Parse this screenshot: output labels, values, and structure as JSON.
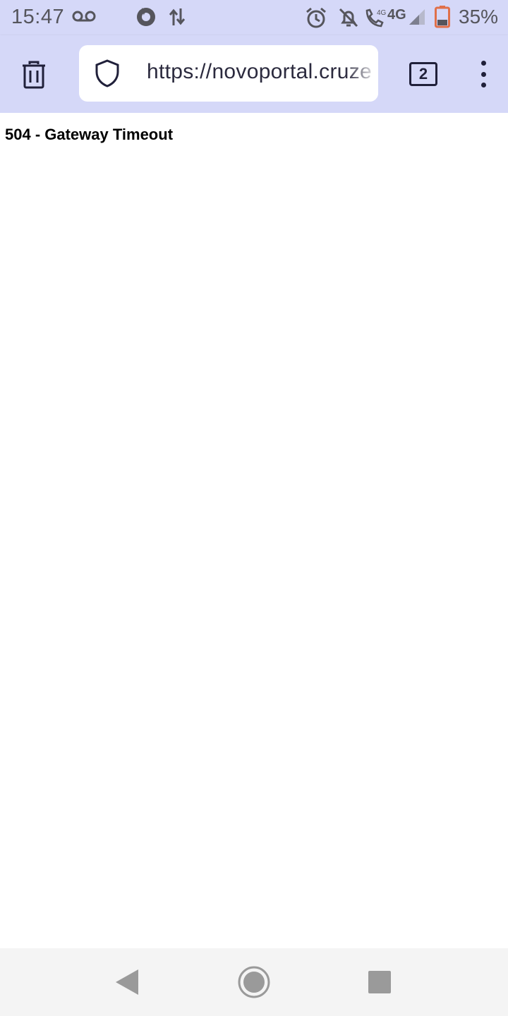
{
  "status_bar": {
    "time": "15:47",
    "network": "4G",
    "battery_percent": "35%",
    "battery_level": 0.35,
    "icons": [
      "voicemail-icon",
      "firefox-icon",
      "data-transfer-icon",
      "alarm-icon",
      "bell-off-icon",
      "volte-call-icon",
      "signal-icon",
      "battery-icon"
    ]
  },
  "toolbar": {
    "url": "https://novoportal.cruze",
    "tab_count": "2",
    "icons": [
      "trash-icon",
      "shield-icon",
      "more-vert-icon"
    ]
  },
  "page": {
    "heading": "504 - Gateway Timeout"
  },
  "nav_bar": {
    "icons": [
      "back-icon",
      "home-icon",
      "recents-icon"
    ]
  },
  "colors": {
    "toolbar_bg": "#d5d8f8",
    "icon_dark": "#20203a",
    "status_text": "#55555c",
    "battery_low": "#e0704a"
  }
}
